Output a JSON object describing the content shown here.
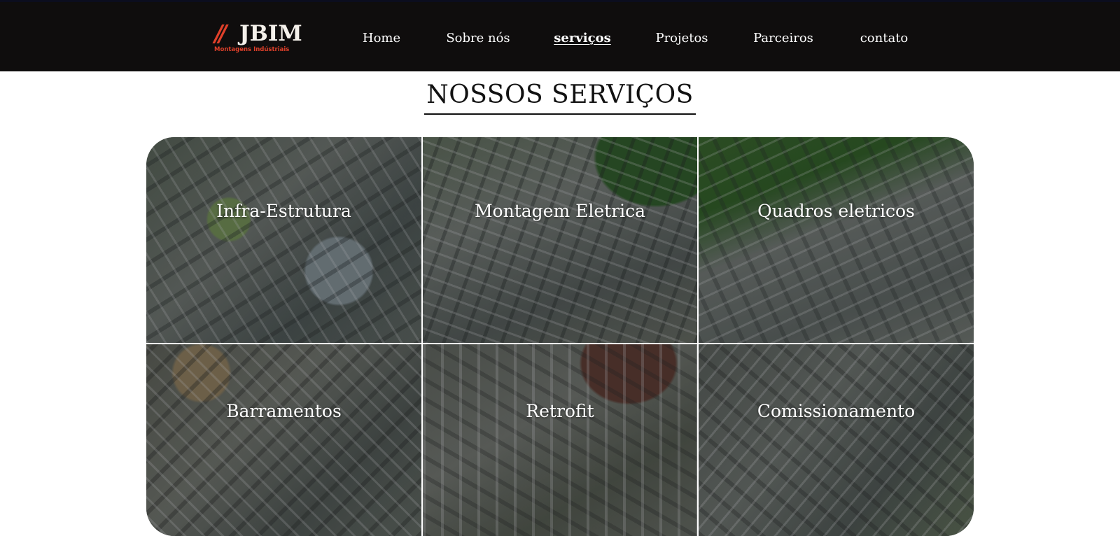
{
  "brand": {
    "logo_slashes": "//",
    "logo_name": "JBIM",
    "logo_tagline": "Montagens Indústriais",
    "accent_color": "#e0402a"
  },
  "nav": {
    "items": [
      {
        "label": "Home",
        "active": false
      },
      {
        "label": "Sobre nós",
        "active": false
      },
      {
        "label": "serviços",
        "active": true
      },
      {
        "label": "Projetos",
        "active": false
      },
      {
        "label": "Parceiros",
        "active": false
      },
      {
        "label": "contato",
        "active": false
      }
    ]
  },
  "services": {
    "title": "NOSSOS SERVIÇOS",
    "items": [
      {
        "label": "Infra-Estrutura"
      },
      {
        "label": "Montagem Eletrica"
      },
      {
        "label": "Quadros eletricos"
      },
      {
        "label": "Barramentos"
      },
      {
        "label": "Retrofit"
      },
      {
        "label": "Comissionamento"
      }
    ]
  }
}
